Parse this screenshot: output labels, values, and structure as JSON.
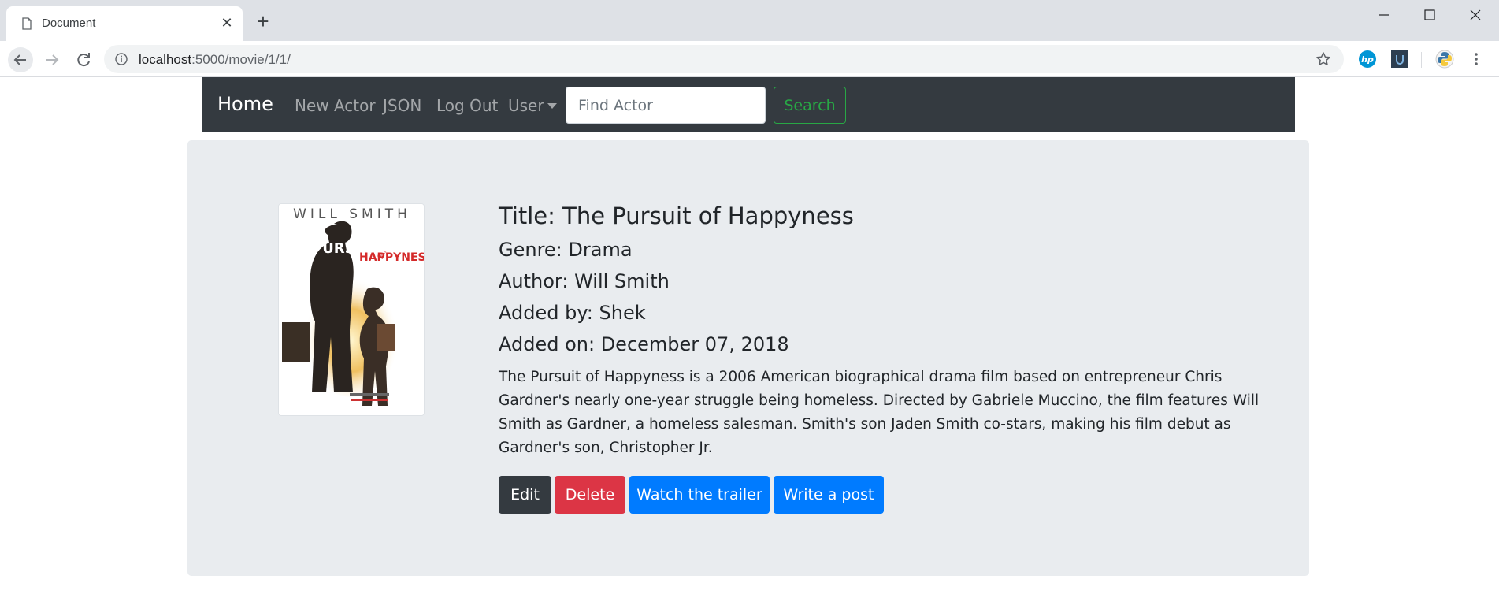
{
  "browser": {
    "tab_title": "Document",
    "url_host": "localhost",
    "url_rest": ":5000/movie/1/1/"
  },
  "navbar": {
    "brand": "Home",
    "links": [
      "New Actor",
      "JSON",
      "Log Out",
      "User"
    ],
    "search_placeholder": "Find Actor",
    "search_button": "Search"
  },
  "movie": {
    "poster_name": "WILL SMITH",
    "title": "Title: The Pursuit of Happyness",
    "genre": "Genre: Drama",
    "author": "Author: Will Smith",
    "added_by": "Added by: Shek",
    "added_on": "Added on: December 07, 2018",
    "description": "The Pursuit of Happyness is a 2006 American biographical drama film based on entrepreneur Chris Gardner's nearly one-year struggle being homeless. Directed by Gabriele Muccino, the film features Will Smith as Gardner, a homeless salesman. Smith's son Jaden Smith co-stars, making his film debut as Gardner's son, Christopher Jr."
  },
  "actions": {
    "edit": "Edit",
    "delete": "Delete",
    "trailer": "Watch the trailer",
    "post": "Write a post"
  },
  "colors": {
    "navbar_bg": "#343a40",
    "jumbotron_bg": "#e9ecef",
    "primary": "#007bff",
    "danger": "#dc3545",
    "success": "#28a745",
    "dark": "#343a40"
  },
  "icons": {
    "tab": "document-icon",
    "back": "arrow-left-icon",
    "forward": "arrow-right-icon",
    "reload": "reload-icon",
    "info": "info-icon",
    "bookmark": "star-icon",
    "menu": "more-vert-icon"
  }
}
